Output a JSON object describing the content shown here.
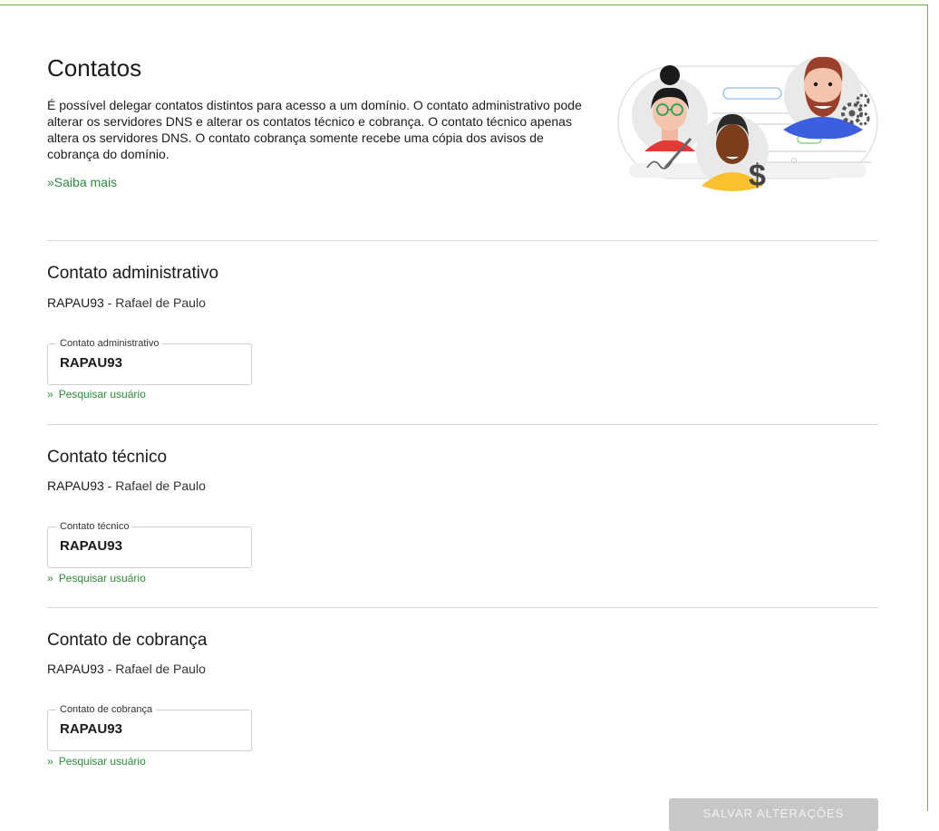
{
  "header": {
    "title": "Contatos",
    "intro": "É possível delegar contatos distintos para acesso a um domínio. O contato administrativo pode alterar os servidores DNS e alterar os contatos técnico e cobrança. O contato técnico apenas altera os servidores DNS. O contato cobrança somente recebe uma cópia dos avisos de cobrança do domínio.",
    "learn_more": "Saiba mais"
  },
  "sections": [
    {
      "title": "Contato administrativo",
      "code": "RAPAU93",
      "separator": " - ",
      "name": "Rafael de Paulo",
      "field_label": "Contato administrativo",
      "field_value": "RAPAU93",
      "search_label": "Pesquisar usuário"
    },
    {
      "title": "Contato técnico",
      "code": "RAPAU93",
      "separator": " - ",
      "name": "Rafael de Paulo",
      "field_label": "Contato técnico",
      "field_value": "RAPAU93",
      "search_label": "Pesquisar usuário"
    },
    {
      "title": "Contato de cobrança",
      "code": "RAPAU93",
      "separator": " - ",
      "name": "Rafael de Paulo",
      "field_label": "Contato de cobrança",
      "field_value": "RAPAU93",
      "search_label": "Pesquisar usuário"
    }
  ],
  "actions": {
    "save_label": "SALVAR ALTERAÇÕES"
  },
  "chevron": "»",
  "colors": {
    "accent": "#2e8a3a",
    "border": "#6fae4b",
    "button_disabled": "#c7c7c7"
  }
}
